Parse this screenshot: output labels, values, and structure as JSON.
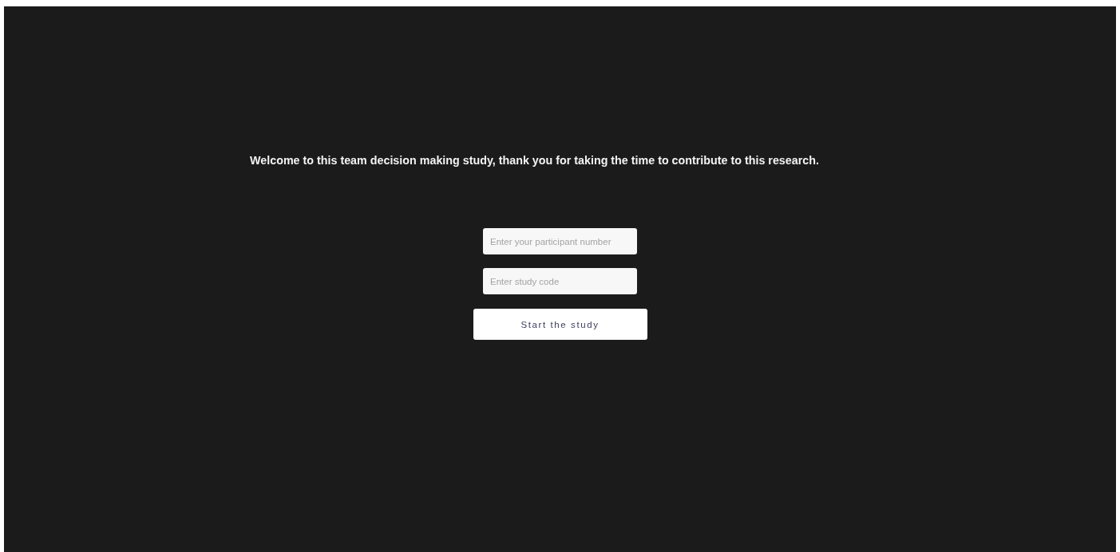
{
  "heading": "Welcome to this team decision making study, thank you for taking the time to contribute to this research.",
  "fields": [
    {
      "placeholder": "Enter your participant number"
    },
    {
      "placeholder": "Enter study code"
    }
  ],
  "button": "Start the study"
}
